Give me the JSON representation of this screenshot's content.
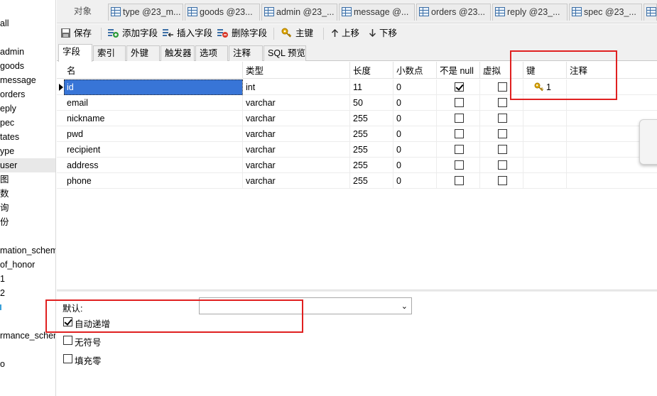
{
  "sidebar": {
    "items": [
      {
        "label": "all"
      },
      {
        "label": "admin"
      },
      {
        "label": "goods"
      },
      {
        "label": "message"
      },
      {
        "label": "orders"
      },
      {
        "label": "eply"
      },
      {
        "label": "pec"
      },
      {
        "label": "tates"
      },
      {
        "label": "ype"
      },
      {
        "label": "user"
      },
      {
        "label": "图"
      },
      {
        "label": "数"
      },
      {
        "label": "询"
      },
      {
        "label": "份"
      },
      {
        "label": "mation_schem"
      },
      {
        "label": "of_honor"
      },
      {
        "label": "1"
      },
      {
        "label": "2"
      },
      {
        "label": "rmance_schen"
      },
      {
        "label": "o"
      }
    ]
  },
  "tabs": [
    {
      "label": "对象"
    },
    {
      "label": "type @23_m..."
    },
    {
      "label": "goods @23..."
    },
    {
      "label": "admin @23_..."
    },
    {
      "label": "message @..."
    },
    {
      "label": "orders @23..."
    },
    {
      "label": "reply @23_..."
    },
    {
      "label": "spec @23_..."
    }
  ],
  "toolbar": {
    "save": "保存",
    "add_field": "添加字段",
    "insert_field": "插入字段",
    "delete_field": "删除字段",
    "primary_key": "主键",
    "move_up": "上移",
    "move_down": "下移"
  },
  "subtabs": [
    {
      "label": "字段"
    },
    {
      "label": "索引"
    },
    {
      "label": "外键"
    },
    {
      "label": "触发器"
    },
    {
      "label": "选项"
    },
    {
      "label": "注释"
    },
    {
      "label": "SQL 预览"
    }
  ],
  "grid": {
    "headers": {
      "name": "名",
      "type": "类型",
      "length": "长度",
      "decimals": "小数点",
      "not_null": "不是 null",
      "virtual": "虚拟",
      "key": "键",
      "comment": "注释"
    },
    "rows": [
      {
        "name": "id",
        "type": "int",
        "length": "11",
        "decimals": "0",
        "not_null": true,
        "virtual": false,
        "key": "1",
        "comment": ""
      },
      {
        "name": "email",
        "type": "varchar",
        "length": "50",
        "decimals": "0",
        "not_null": false,
        "virtual": false,
        "key": "",
        "comment": ""
      },
      {
        "name": "nickname",
        "type": "varchar",
        "length": "255",
        "decimals": "0",
        "not_null": false,
        "virtual": false,
        "key": "",
        "comment": ""
      },
      {
        "name": "pwd",
        "type": "varchar",
        "length": "255",
        "decimals": "0",
        "not_null": false,
        "virtual": false,
        "key": "",
        "comment": ""
      },
      {
        "name": "recipient",
        "type": "varchar",
        "length": "255",
        "decimals": "0",
        "not_null": false,
        "virtual": false,
        "key": "",
        "comment": ""
      },
      {
        "name": "address",
        "type": "varchar",
        "length": "255",
        "decimals": "0",
        "not_null": false,
        "virtual": false,
        "key": "",
        "comment": ""
      },
      {
        "name": "phone",
        "type": "varchar",
        "length": "255",
        "decimals": "0",
        "not_null": false,
        "virtual": false,
        "key": "",
        "comment": ""
      }
    ]
  },
  "bottom": {
    "default_label": "默认:",
    "default_value": "",
    "auto_increment": {
      "label": "自动递增",
      "checked": true
    },
    "unsigned": {
      "label": "无符号",
      "checked": false
    },
    "zerofill": {
      "label": "填充零",
      "checked": false
    }
  },
  "colors": {
    "annotation_red": "#e02020",
    "selection_blue": "#3875d7",
    "key_gold": "#d9a400"
  }
}
